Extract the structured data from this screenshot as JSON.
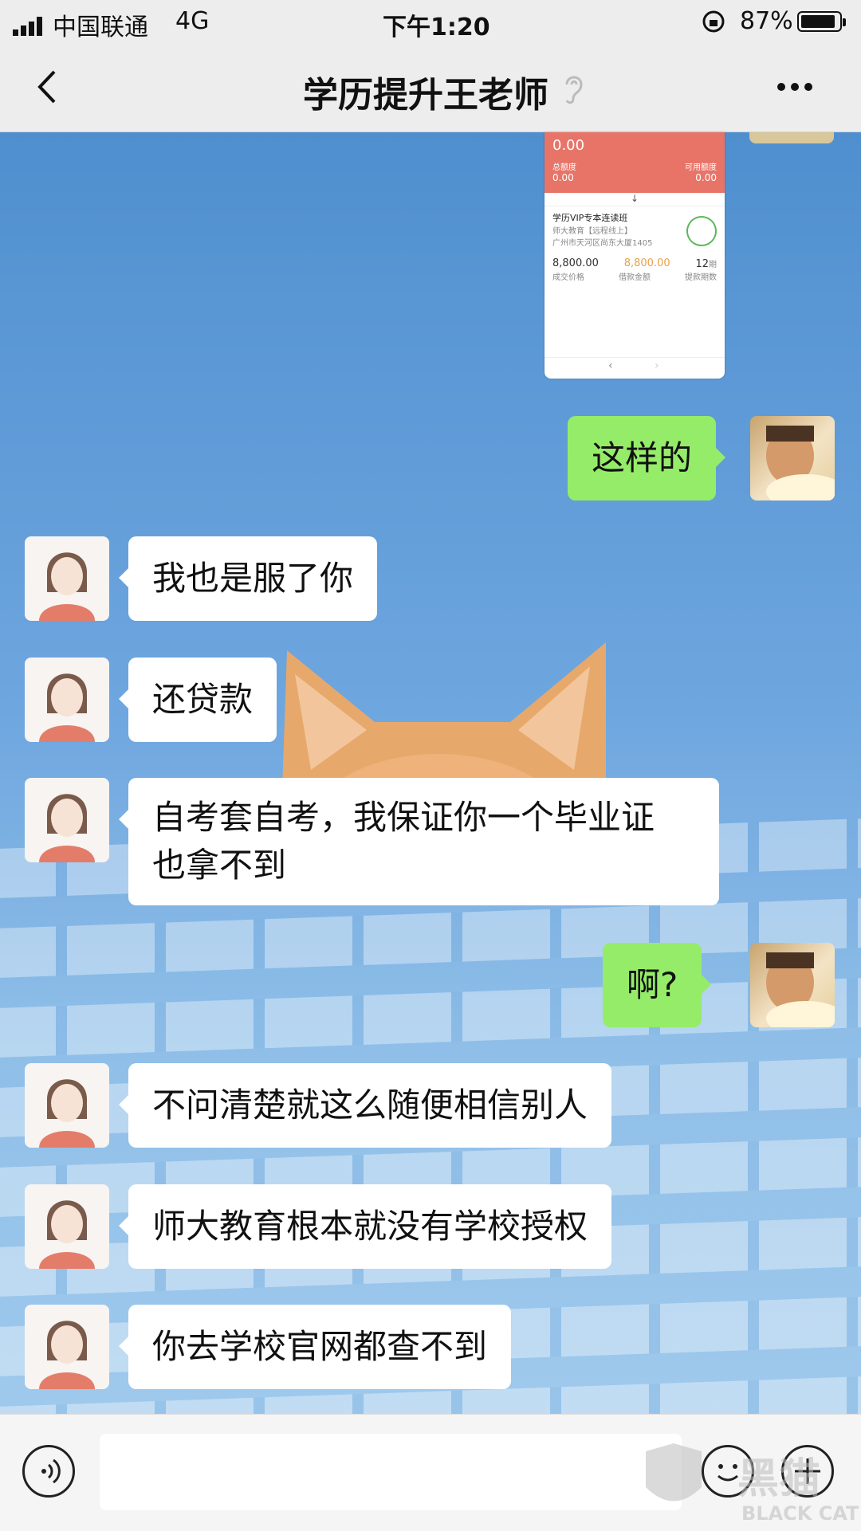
{
  "status": {
    "carrier": "中国联通",
    "network": "4G",
    "time": "下午1:20",
    "battery": "87%"
  },
  "header": {
    "title": "学历提升王老师",
    "back_icon": "chevron-left-icon",
    "ear_icon": "ear-icon",
    "more_icon": "more-dots-icon"
  },
  "shared_image": {
    "amount_top": "0.00",
    "label_total": "总额度",
    "label_available": "可用额度",
    "val_total": "0.00",
    "val_available": "0.00",
    "course": "学历VIP专本连读班",
    "sub1": "师大教育【远程线上】",
    "sub2": "广州市天河区尚东大厦1405",
    "price": "8,800.00",
    "loan": "8,800.00",
    "term": "12",
    "term_unit": "期",
    "label_price": "成交价格",
    "label_loan": "借款金额",
    "label_term": "提款期数",
    "nav_left": "‹",
    "nav_right": "›"
  },
  "messages": [
    {
      "side": "right",
      "text": "这样的"
    },
    {
      "side": "left",
      "text": "我也是服了你"
    },
    {
      "side": "left",
      "text": "还贷款"
    },
    {
      "side": "left",
      "text": "自考套自考，我保证你一个毕业证也拿不到",
      "line1": "自考套自考，我保证你一个毕业证",
      "line2": "也拿不到"
    },
    {
      "side": "right",
      "text": "啊?"
    },
    {
      "side": "left",
      "text": "不问清楚就这么随便相信别人"
    },
    {
      "side": "left",
      "text": "师大教育根本就没有学校授权"
    },
    {
      "side": "left",
      "text": "你去学校官网都查不到"
    }
  ],
  "input": {
    "voice_icon": "voice-icon",
    "emoji_icon": "emoji-icon",
    "plus_icon": "plus-icon"
  },
  "watermark": {
    "cn": "黑猫",
    "en": "BLACK CAT"
  }
}
